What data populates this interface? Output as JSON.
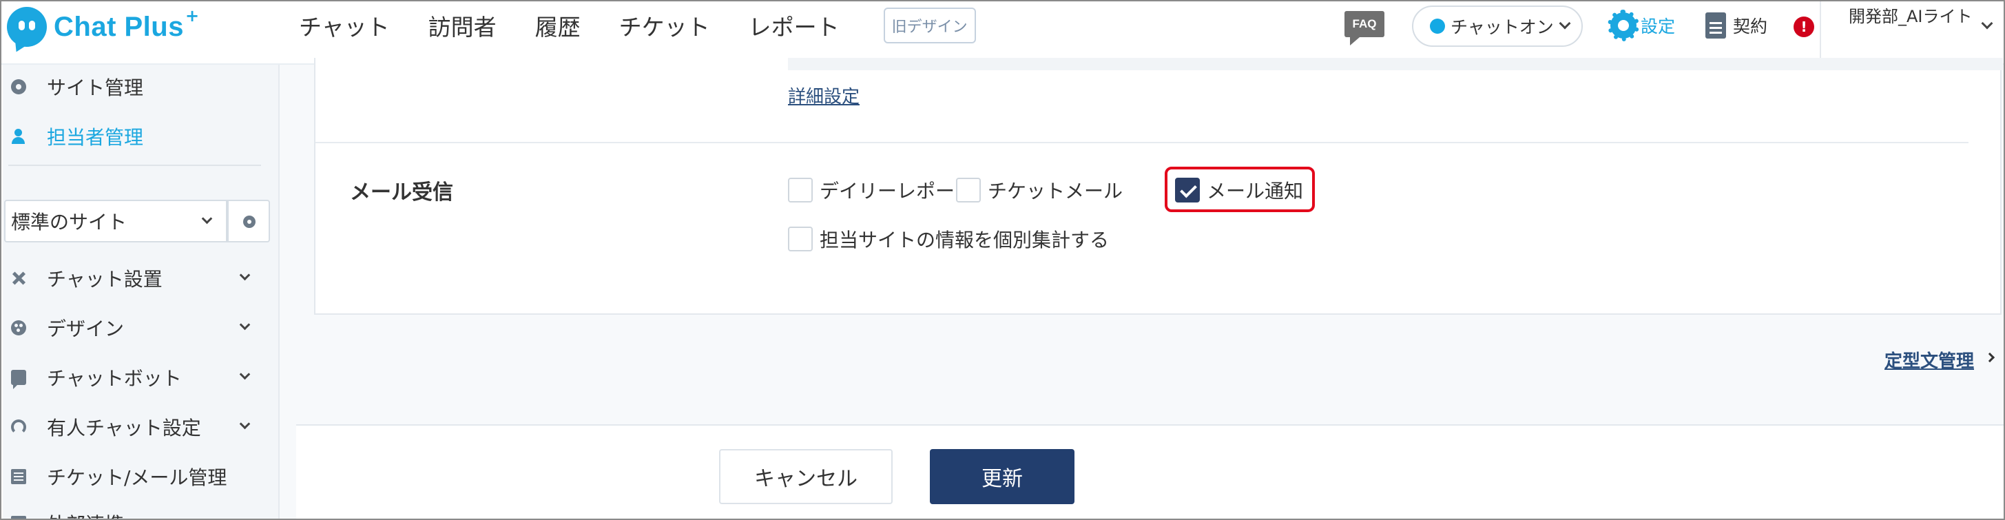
{
  "header": {
    "logo_text": "Chat Plus",
    "logo_plus": "+",
    "nav": [
      "チャット",
      "訪問者",
      "履歴",
      "チケット",
      "レポート"
    ],
    "old_design": "旧デザイン",
    "faq": "FAQ",
    "chat_status": "チャットオン",
    "settings": "設定",
    "contract": "契約",
    "alert": "!",
    "user_name": "開発部_AIライト"
  },
  "sidebar": {
    "top_items": [
      {
        "label": "サイト管理",
        "icon": "gear-icon"
      },
      {
        "label": "担当者管理",
        "icon": "user-icon"
      }
    ],
    "site_select": "標準のサイト",
    "items": [
      {
        "label": "チャット設置",
        "icon": "tools-icon"
      },
      {
        "label": "デザイン",
        "icon": "palette-icon"
      },
      {
        "label": "チャットボット",
        "icon": "chat-bubble-icon"
      },
      {
        "label": "有人チャット設定",
        "icon": "headset-icon"
      },
      {
        "label": "チケット/メール管理",
        "icon": "list-icon"
      },
      {
        "label": "外部連携",
        "icon": "link-icon"
      }
    ]
  },
  "main": {
    "detail_link": "詳細設定",
    "mail_section": {
      "label": "メール受信",
      "options": [
        {
          "label": "デイリーレポート",
          "checked": false
        },
        {
          "label": "チケットメール",
          "checked": false
        },
        {
          "label": "メール通知",
          "checked": true
        },
        {
          "label": "担当サイトの情報を個別集計する",
          "checked": false
        }
      ]
    },
    "template_link": "定型文管理",
    "cancel": "キャンセル",
    "update": "更新"
  },
  "colors": {
    "brand": "#1ba7e0",
    "primary_button": "#223e6e",
    "highlight": "#e3071b",
    "link": "#2b4f7e"
  }
}
